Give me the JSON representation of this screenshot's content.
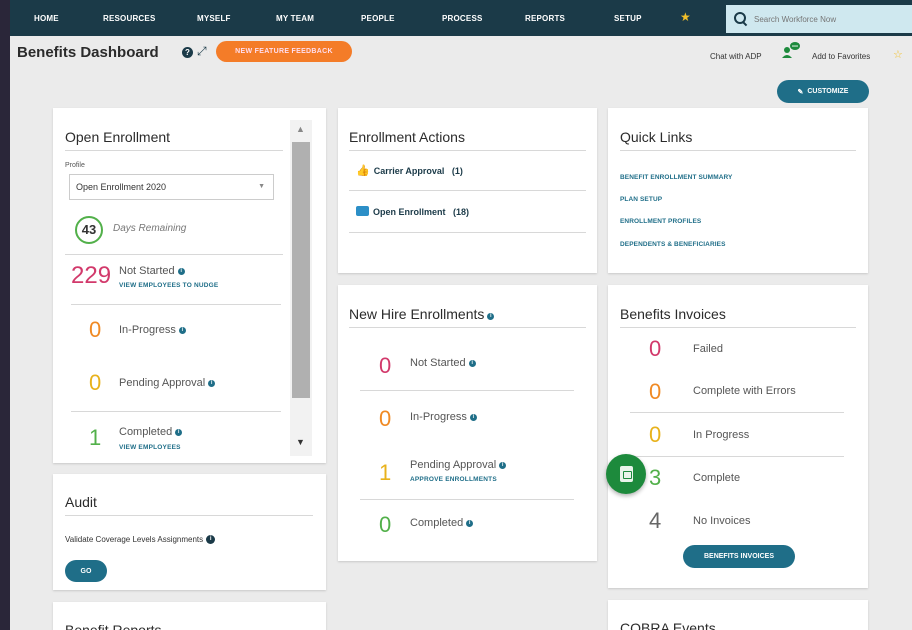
{
  "nav": {
    "items": [
      "HOME",
      "RESOURCES",
      "MYSELF",
      "MY TEAM",
      "PEOPLE",
      "PROCESS",
      "REPORTS",
      "SETUP"
    ],
    "search_placeholder": "Search Workforce Now"
  },
  "header": {
    "title": "Benefits Dashboard",
    "feedback_label": "NEW FEATURE FEEDBACK",
    "chat_label": "Chat with ADP",
    "favorites_label": "Add to Favorites",
    "customize_label": "CUSTOMIZE"
  },
  "open_enrollment": {
    "title": "Open Enrollment",
    "profile_label": "Profile",
    "profile_value": "Open Enrollment 2020",
    "days": "43",
    "days_label": "Days Remaining",
    "not_started_count": "229",
    "not_started_label": "Not Started",
    "nudge_link": "VIEW EMPLOYEES TO NUDGE",
    "in_progress_count": "0",
    "in_progress_label": "In-Progress",
    "pending_count": "0",
    "pending_label": "Pending Approval",
    "completed_count": "1",
    "completed_label": "Completed",
    "view_link": "VIEW EMPLOYEES"
  },
  "audit": {
    "title": "Audit",
    "text": "Validate Coverage Levels Assignments",
    "go_label": "GO"
  },
  "benefit_reports": {
    "title": "Benefit Reports"
  },
  "enrollment_actions": {
    "title": "Enrollment Actions",
    "items": [
      {
        "label": "Carrier Approval",
        "count": "(1)"
      },
      {
        "label": "Open Enrollment",
        "count": "(18)"
      }
    ]
  },
  "new_hire": {
    "title": "New Hire Enrollments",
    "not_started_count": "0",
    "not_started_label": "Not Started",
    "in_progress_count": "0",
    "in_progress_label": "In-Progress",
    "pending_count": "1",
    "pending_label": "Pending Approval",
    "approve_link": "APPROVE ENROLLMENTS",
    "completed_count": "0",
    "completed_label": "Completed"
  },
  "quick_links": {
    "title": "Quick Links",
    "items": [
      "BENEFIT ENROLLMENT SUMMARY",
      "PLAN SETUP",
      "ENROLLMENT PROFILES",
      "DEPENDENTS & BENEFICIARIES"
    ]
  },
  "invoices": {
    "title": "Benefits Invoices",
    "rows": [
      {
        "count": "0",
        "label": "Failed"
      },
      {
        "count": "0",
        "label": "Complete with Errors"
      },
      {
        "count": "0",
        "label": "In Progress"
      },
      {
        "count": "3",
        "label": "Complete"
      },
      {
        "count": "4",
        "label": "No Invoices"
      }
    ],
    "button_label": "BENEFITS INVOICES"
  },
  "cobra": {
    "title": "COBRA Events"
  }
}
